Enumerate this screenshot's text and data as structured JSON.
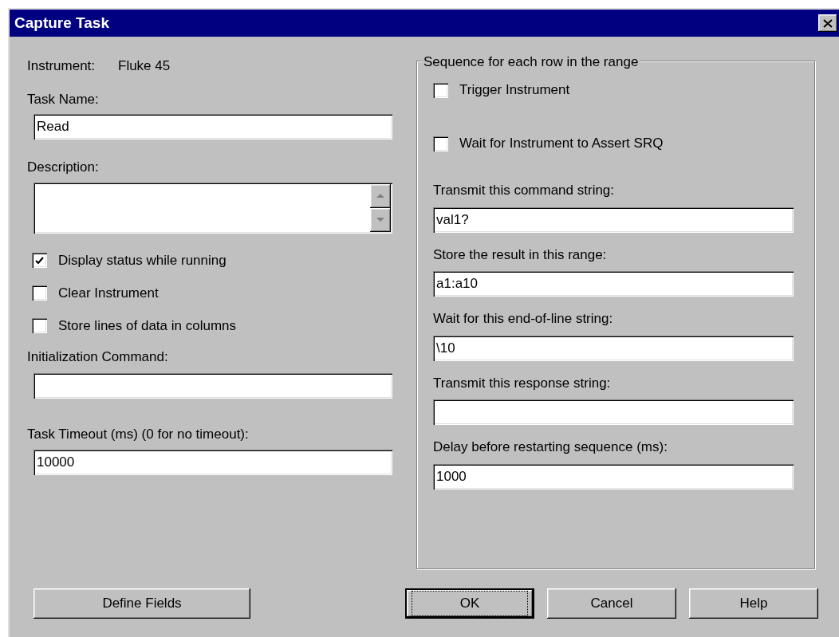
{
  "window": {
    "title": "Capture Task"
  },
  "instrument": {
    "label": "Instrument:",
    "value": "Fluke 45"
  },
  "task_name": {
    "label": "Task Name:",
    "value": "Read"
  },
  "description": {
    "label": "Description:"
  },
  "options": [
    {
      "label": "Display status while running",
      "checked": true
    },
    {
      "label": "Clear Instrument",
      "checked": false
    },
    {
      "label": "Store lines of data in columns",
      "checked": false
    }
  ],
  "init_command": {
    "label": "Initialization Command:"
  },
  "timeout": {
    "label": "Task Timeout (ms) (0 for no timeout):",
    "value": "10000"
  },
  "sequence": {
    "title": "Sequence for each row in the range",
    "checkboxes": [
      {
        "label": "Trigger Instrument",
        "checked": false
      },
      {
        "label": "Wait for Instrument to Assert SRQ",
        "checked": false
      }
    ],
    "fields": [
      {
        "label": "Transmit this command string:",
        "value": "val1?"
      },
      {
        "label": "Store the result in this range:",
        "value": "a1:a10"
      },
      {
        "label": "Wait for this end-of-line string:",
        "value": "\\10"
      },
      {
        "label": "Transmit this response string:"
      },
      {
        "label": "Delay before restarting sequence (ms):",
        "value": "1000"
      }
    ]
  },
  "buttons": [
    {
      "label": "Define Fields",
      "focused": false
    },
    {
      "label": "OK",
      "focused": true
    },
    {
      "label": "Cancel",
      "focused": false
    },
    {
      "label": "Help",
      "focused": false
    }
  ]
}
